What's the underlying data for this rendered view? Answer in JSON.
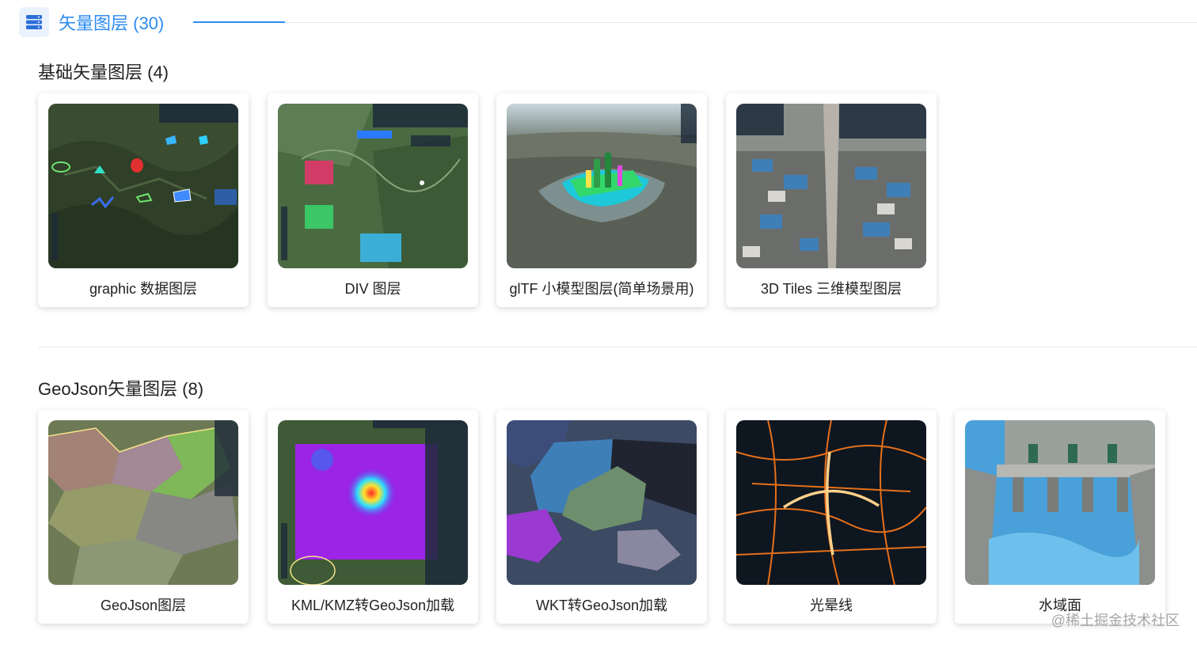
{
  "header": {
    "title": "矢量图层 (30)",
    "icon": "server-stack-icon",
    "accent": "#2d8cf0"
  },
  "sections": [
    {
      "title": "基础矢量图层 (4)",
      "cards": [
        {
          "label": "graphic 数据图层",
          "thumbnail": "terrain-graphics-thumbnail"
        },
        {
          "label": "DIV 图层",
          "thumbnail": "div-popup-thumbnail"
        },
        {
          "label": "glTF 小模型图层(简单场景用)",
          "thumbnail": "city-model-thumbnail"
        },
        {
          "label": "3D Tiles 三维模型图层",
          "thumbnail": "tileset-village-thumbnail"
        }
      ]
    },
    {
      "title": "GeoJson矢量图层 (8)",
      "cards": [
        {
          "label": "GeoJson图层",
          "thumbnail": "district-polygons-thumbnail"
        },
        {
          "label": "KML/KMZ转GeoJson加载",
          "thumbnail": "kml-heatmap-thumbnail"
        },
        {
          "label": "WKT转GeoJson加载",
          "thumbnail": "wkt-regions-thumbnail"
        },
        {
          "label": "光晕线",
          "thumbnail": "glow-lines-thumbnail"
        },
        {
          "label": "水域面",
          "thumbnail": "water-surface-thumbnail"
        }
      ]
    }
  ],
  "watermark": "@稀土掘金技术社区"
}
